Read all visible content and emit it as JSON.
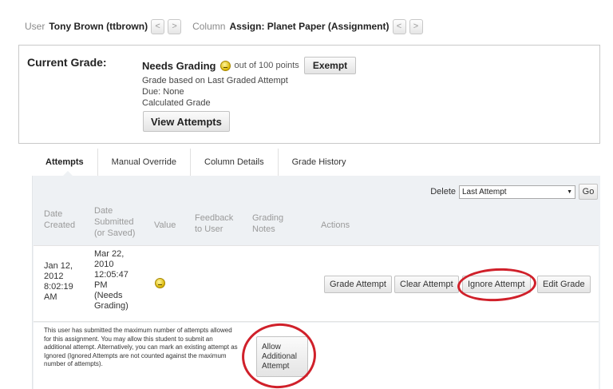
{
  "header": {
    "user_label": "User",
    "user_value": "Tony Brown (ttbrown)",
    "column_label": "Column",
    "column_value": "Assign: Planet Paper (Assignment)",
    "prev_glyph": "<",
    "next_glyph": ">"
  },
  "current_grade": {
    "label": "Current Grade:",
    "status": "Needs Grading",
    "status_icon": "needs-grading-icon",
    "out_of": "out of 100 points",
    "exempt_label": "Exempt",
    "lines": [
      "Grade based on Last Graded Attempt",
      "Due: None",
      "Calculated Grade"
    ],
    "view_attempts_label": "View Attempts"
  },
  "tabs": [
    {
      "label": "Attempts",
      "active": true
    },
    {
      "label": "Manual Override",
      "active": false
    },
    {
      "label": "Column Details",
      "active": false
    },
    {
      "label": "Grade History",
      "active": false
    }
  ],
  "delete": {
    "label": "Delete",
    "selected": "Last Attempt",
    "go_label": "Go"
  },
  "table": {
    "headers": [
      [
        "Date",
        "Created"
      ],
      [
        "Date",
        "Submitted",
        "(or Saved)"
      ],
      [
        "Value"
      ],
      [
        "Feedback",
        "to User"
      ],
      [
        "Grading",
        "Notes"
      ],
      [
        "Actions"
      ]
    ],
    "row": {
      "created": [
        "Jan 12,",
        "2012",
        "8:02:19",
        "AM"
      ],
      "submitted": [
        "Mar 22,",
        "2010",
        "12:05:47",
        "PM",
        "(Needs",
        "Grading)"
      ],
      "value_icon": "needs-grading-icon",
      "actions": [
        "Grade Attempt",
        "Clear Attempt",
        "Ignore Attempt",
        "Edit Grade"
      ]
    }
  },
  "footer": {
    "note": "This user has submitted the maximum number of attempts allowed for this assignment. You may allow this student to submit an additional attempt. Alternatively, you can mark an existing attempt as Ignored (Ignored Attempts are not counted against the maximum number of attempts).",
    "allow_lines": [
      "Allow",
      "Additional",
      "Attempt"
    ]
  },
  "colors": {
    "highlight_circle": "#d0202a",
    "panel_bg": "#eef1f4"
  }
}
